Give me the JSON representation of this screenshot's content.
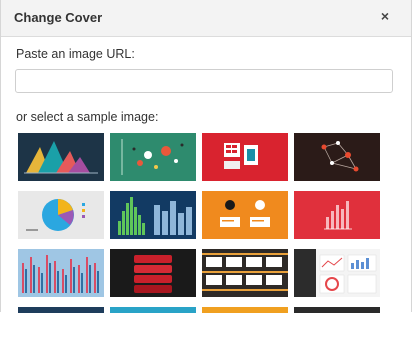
{
  "dialog": {
    "title": "Change Cover",
    "close_glyph": "×",
    "url_label": "Paste an image URL:",
    "url_value": "",
    "url_placeholder": "",
    "sample_label": "or select a sample image:"
  },
  "samples": [
    {
      "name": "sample-mountain-chart",
      "bg": "#1d3447"
    },
    {
      "name": "sample-green-dots",
      "bg": "#2e8b6e"
    },
    {
      "name": "sample-red-tables",
      "bg": "#d9232f"
    },
    {
      "name": "sample-network-graph",
      "bg": "#2b1b18"
    },
    {
      "name": "sample-pie-chart",
      "bg": "#e8e8e8"
    },
    {
      "name": "sample-bar-city",
      "bg": "#123a63"
    },
    {
      "name": "sample-orange-ab",
      "bg": "#f08a1e"
    },
    {
      "name": "sample-red-bars",
      "bg": "#e0303c"
    },
    {
      "name": "sample-blue-striped-bars",
      "bg": "#9fc6e4"
    },
    {
      "name": "sample-red-stack",
      "bg": "#1a1a1a"
    },
    {
      "name": "sample-timeline-cards",
      "bg": "#2e2a27"
    },
    {
      "name": "sample-dashboard",
      "bg": "#f4f4f4"
    },
    {
      "name": "sample-partial-1",
      "bg": "#1e3d5c"
    },
    {
      "name": "sample-partial-2",
      "bg": "#29a3c7"
    },
    {
      "name": "sample-partial-3",
      "bg": "#f0a020"
    },
    {
      "name": "sample-partial-4",
      "bg": "#2a2a2a"
    }
  ]
}
